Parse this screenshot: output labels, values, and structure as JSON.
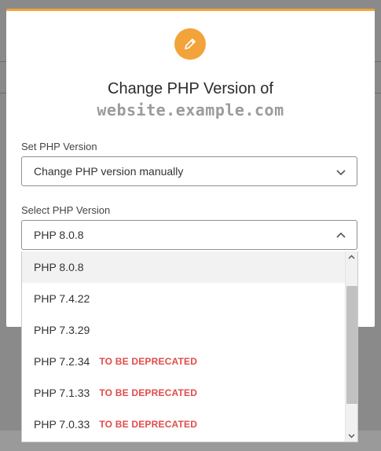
{
  "modal": {
    "title": "Change PHP Version of",
    "subtitle": "website.example.com",
    "edit_icon": "pencil-icon",
    "accent_color": "#f2a33a"
  },
  "set_php": {
    "label": "Set PHP Version",
    "value": "Change PHP version manually"
  },
  "select_php": {
    "label": "Select PHP Version",
    "value": "PHP 8.0.8"
  },
  "dropdown": {
    "options": [
      {
        "label": "PHP 8.0.8",
        "badge": ""
      },
      {
        "label": "PHP 7.4.22",
        "badge": ""
      },
      {
        "label": "PHP 7.3.29",
        "badge": ""
      },
      {
        "label": "PHP 7.2.34",
        "badge": "TO BE DEPRECATED"
      },
      {
        "label": "PHP 7.1.33",
        "badge": "TO BE DEPRECATED"
      },
      {
        "label": "PHP 7.0.33",
        "badge": "TO BE DEPRECATED"
      }
    ],
    "deprecated_color": "#e24b4b"
  }
}
